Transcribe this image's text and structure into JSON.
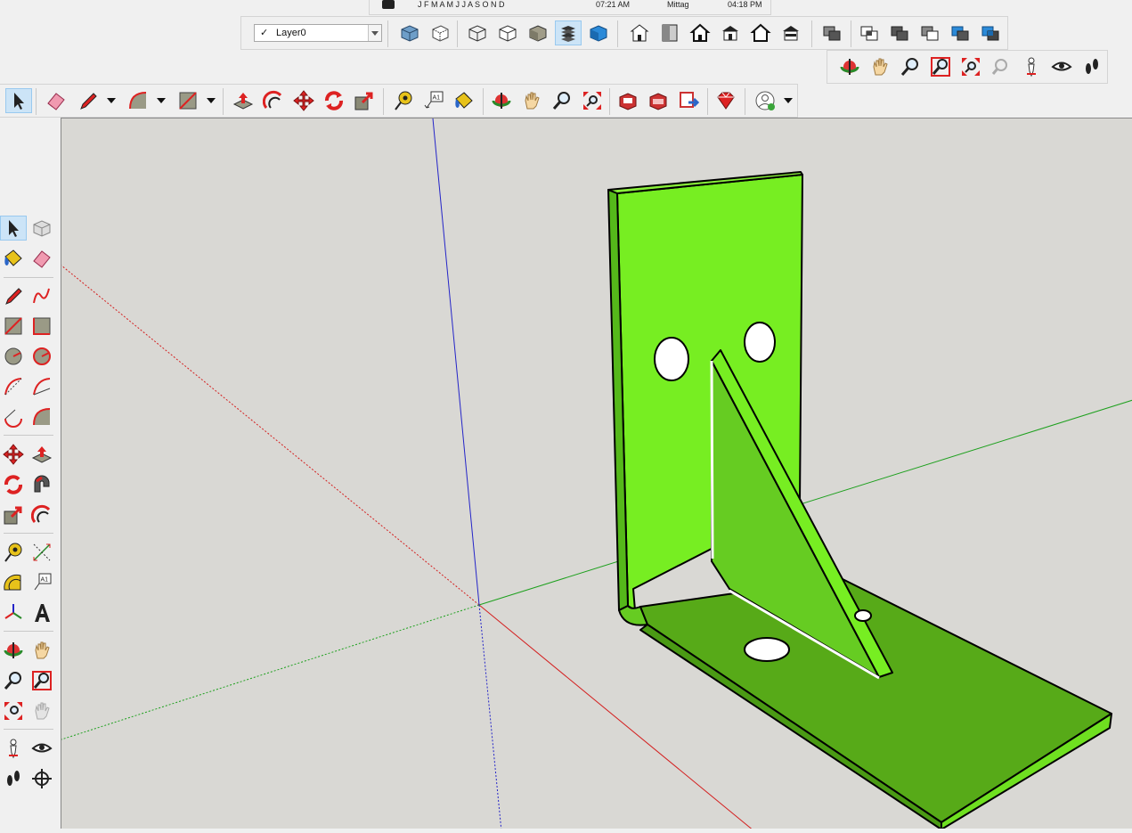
{
  "timeline": {
    "months": "J  F  M  A  M  J  J  A  S  O  N  D",
    "time_start": "07:21 AM",
    "noon": "Mittag",
    "time_end": "04:18 PM"
  },
  "layers": {
    "current": "Layer0",
    "checked_mark": "✓"
  },
  "colors": {
    "viewport_bg": "#d9d8d4",
    "model_face_light": "#77ee22",
    "model_face_mid": "#66cc22",
    "model_face_dark": "#55aa18",
    "axis_red": "#d42020",
    "axis_green": "#1ea01e",
    "axis_blue": "#2424c8",
    "active_tool_bg": "#cce4f7"
  },
  "toolbars": {
    "styles": [
      "xray-style-icon",
      "back-edges-style-icon",
      "wireframe-style-icon",
      "hidden-line-style-icon",
      "shaded-style-icon",
      "shaded-with-textures-style-icon",
      "monochrome-style-icon"
    ],
    "views": [
      "iso-view-icon",
      "top-view-icon",
      "front-view-icon",
      "right-view-icon",
      "back-view-icon",
      "left-view-icon"
    ],
    "camera": [
      "orbit-icon",
      "pan-icon",
      "zoom-icon",
      "zoom-window-icon",
      "zoom-extents-icon",
      "previous-view-icon",
      "position-camera-icon",
      "look-around-icon",
      "walk-icon"
    ],
    "main": [
      "select-icon",
      "eraser-icon",
      "line-icon",
      "arc-icon",
      "rectangle-icon",
      "push-pull-icon",
      "offset-icon",
      "move-icon",
      "rotate-icon",
      "scale-icon",
      "tape-measure-icon",
      "text-icon",
      "paint-bucket-icon",
      "orbit-icon",
      "pan-icon",
      "zoom-icon",
      "zoom-extents-icon",
      "3d-warehouse-icon",
      "extension-warehouse-icon",
      "send-to-layout-icon",
      "extension-manager-icon",
      "account-icon"
    ],
    "left": [
      "select-icon",
      "make-component-icon",
      "paint-bucket-icon",
      "eraser-icon",
      "line-icon",
      "freehand-icon",
      "rectangle-icon",
      "rotated-rectangle-icon",
      "circle-icon",
      "polygon-icon",
      "arc-icon",
      "2-point-arc-icon",
      "3-point-arc-icon",
      "pie-icon",
      "move-icon",
      "push-pull-icon",
      "rotate-icon",
      "follow-me-icon",
      "scale-icon",
      "offset-icon",
      "tape-measure-icon",
      "dimensions-icon",
      "protractor-icon",
      "text-icon",
      "axes-icon",
      "3d-text-icon",
      "orbit-icon",
      "pan-icon",
      "zoom-icon",
      "zoom-window-icon",
      "zoom-extents-icon",
      "previous-icon",
      "position-camera-icon",
      "look-around-icon",
      "walk-icon",
      "section-plane-icon"
    ]
  }
}
